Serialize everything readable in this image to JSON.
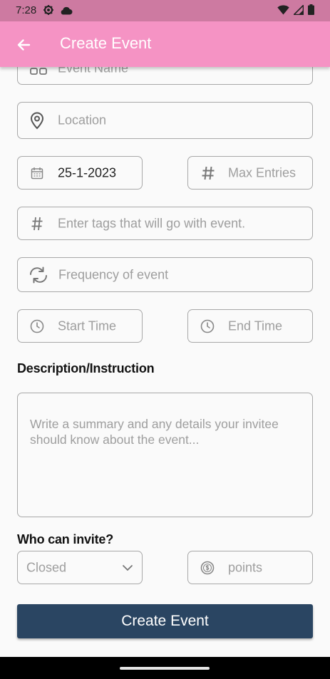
{
  "status": {
    "time": "7:28"
  },
  "header": {
    "title": "Create Event"
  },
  "form": {
    "event_name_placeholder": "Event Name",
    "location_placeholder": "Location",
    "date_value": "25-1-2023",
    "max_entries_placeholder": "Max Entries",
    "tags_placeholder": "Enter tags that will go with event.",
    "frequency_placeholder": "Frequency of event",
    "start_time_placeholder": "Start Time",
    "end_time_placeholder": "End Time",
    "description_label": "Description/Instruction",
    "description_placeholder": "Write a summary and any details your invitee should know about the event...",
    "who_can_invite_label": "Who can invite?",
    "invite_select_value": "Closed",
    "points_placeholder": "points"
  },
  "actions": {
    "create_label": "Create Event"
  },
  "colors": {
    "status_bar": "#cd7aa1",
    "app_bar": "#f593c4",
    "primary_button": "#2a4562"
  }
}
